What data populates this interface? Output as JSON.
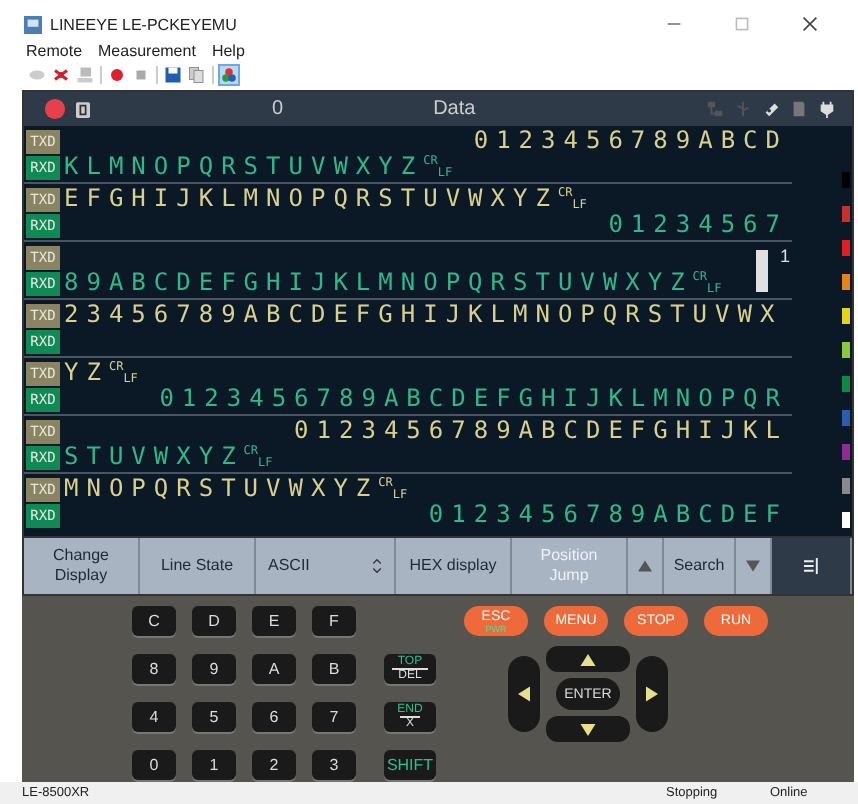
{
  "window": {
    "title": "LINEEYE LE-PCKEYEMU"
  },
  "menu": [
    "Remote",
    "Measurement",
    "Help"
  ],
  "header": {
    "recording": true,
    "counter": "0",
    "title": "Data"
  },
  "pairs": [
    {
      "txd": {
        "label": "TXD",
        "text": "0123456789ABCD",
        "kind": "tail"
      },
      "rxd": {
        "label": "RXD",
        "text": "KLMNOPQRSTUVWXYZ",
        "kind": "lead",
        "eol": [
          "CR",
          "LF"
        ]
      }
    },
    {
      "txd": {
        "label": "TXD",
        "text": "EFGHIJKLMNOPQRSTUVWXYZ",
        "kind": "lead",
        "eol": [
          "CR",
          "LF"
        ]
      },
      "rxd": {
        "label": "RXD",
        "text": "01234567",
        "kind": "tail"
      }
    },
    {
      "txd": {
        "label": "TXD"
      },
      "rxd": {
        "label": "RXD",
        "text": "89ABCDEFGHIJKLMNOPQRSTUVWXYZ",
        "kind": "lead",
        "eol": [
          "CR",
          "LF"
        ]
      },
      "cursor": "1"
    },
    {
      "txd": {
        "label": "TXD",
        "text": "23456789ABCDEFGHIJKLMNOPQRSTUVWX",
        "kind": "lead"
      },
      "rxd": {
        "label": "RXD"
      }
    },
    {
      "txd": {
        "label": "TXD",
        "text": "YZ",
        "kind": "lead",
        "eol": [
          "CR",
          "LF"
        ]
      },
      "rxd": {
        "label": "RXD",
        "text": "0123456789ABCDEFGHIJKLMNOPQR",
        "kind": "tail"
      }
    },
    {
      "txd": {
        "label": "TXD",
        "text": "0123456789ABCDEFGHIJKL",
        "kind": "tail"
      },
      "rxd": {
        "label": "RXD",
        "text": "STUVWXYZ",
        "kind": "lead",
        "eol": [
          "CR",
          "LF"
        ]
      }
    },
    {
      "txd": {
        "label": "TXD",
        "text": "MNOPQRSTUVWXYZ",
        "kind": "lead",
        "eol": [
          "CR",
          "LF"
        ]
      },
      "rxd": {
        "label": "RXD",
        "text": "0123456789ABCDEF",
        "kind": "tail"
      }
    }
  ],
  "color_strip": [
    {
      "color": "#000000"
    },
    {
      "color": "#c8302c"
    },
    {
      "color": "#e02020"
    },
    {
      "color": "#e8821e"
    },
    {
      "color": "#e5d21a"
    },
    {
      "color": "#8dc63f"
    },
    {
      "color": "#0c8a3e"
    },
    {
      "color": "#2a5db0"
    },
    {
      "color": "#8d2c95"
    },
    {
      "color": "#8a8a8a"
    },
    {
      "color": "#ffffff"
    }
  ],
  "bottom_toolbar": [
    {
      "kind": "button",
      "label": "Change Display",
      "disabled": false
    },
    {
      "kind": "button",
      "label": "Line State",
      "disabled": false
    },
    {
      "kind": "spinner",
      "label": "ASCII",
      "disabled": false
    },
    {
      "kind": "button",
      "label": "HEX display",
      "disabled": false
    },
    {
      "kind": "button",
      "label": "Position Jump",
      "disabled": true
    },
    {
      "kind": "up"
    },
    {
      "kind": "button",
      "label": "Search",
      "disabled": false
    },
    {
      "kind": "down"
    },
    {
      "kind": "menu"
    }
  ],
  "hex_keys": [
    "C",
    "D",
    "E",
    "F",
    "8",
    "9",
    "A",
    "B",
    "4",
    "5",
    "6",
    "7",
    "0",
    "1",
    "2",
    "3"
  ],
  "side_keys": [
    {
      "top": "TOP",
      "bottom": "DEL"
    },
    {
      "top": "END",
      "bottom": "X"
    },
    {
      "top": "SHIFT"
    }
  ],
  "action_keys": [
    {
      "label": "ESC",
      "sub": "PWR"
    },
    {
      "label": "MENU"
    },
    {
      "label": "STOP"
    },
    {
      "label": "RUN"
    }
  ],
  "enter_key": "ENTER",
  "status_bar": {
    "model": "LE-8500XR",
    "state": "Stopping",
    "connection": "Online"
  }
}
